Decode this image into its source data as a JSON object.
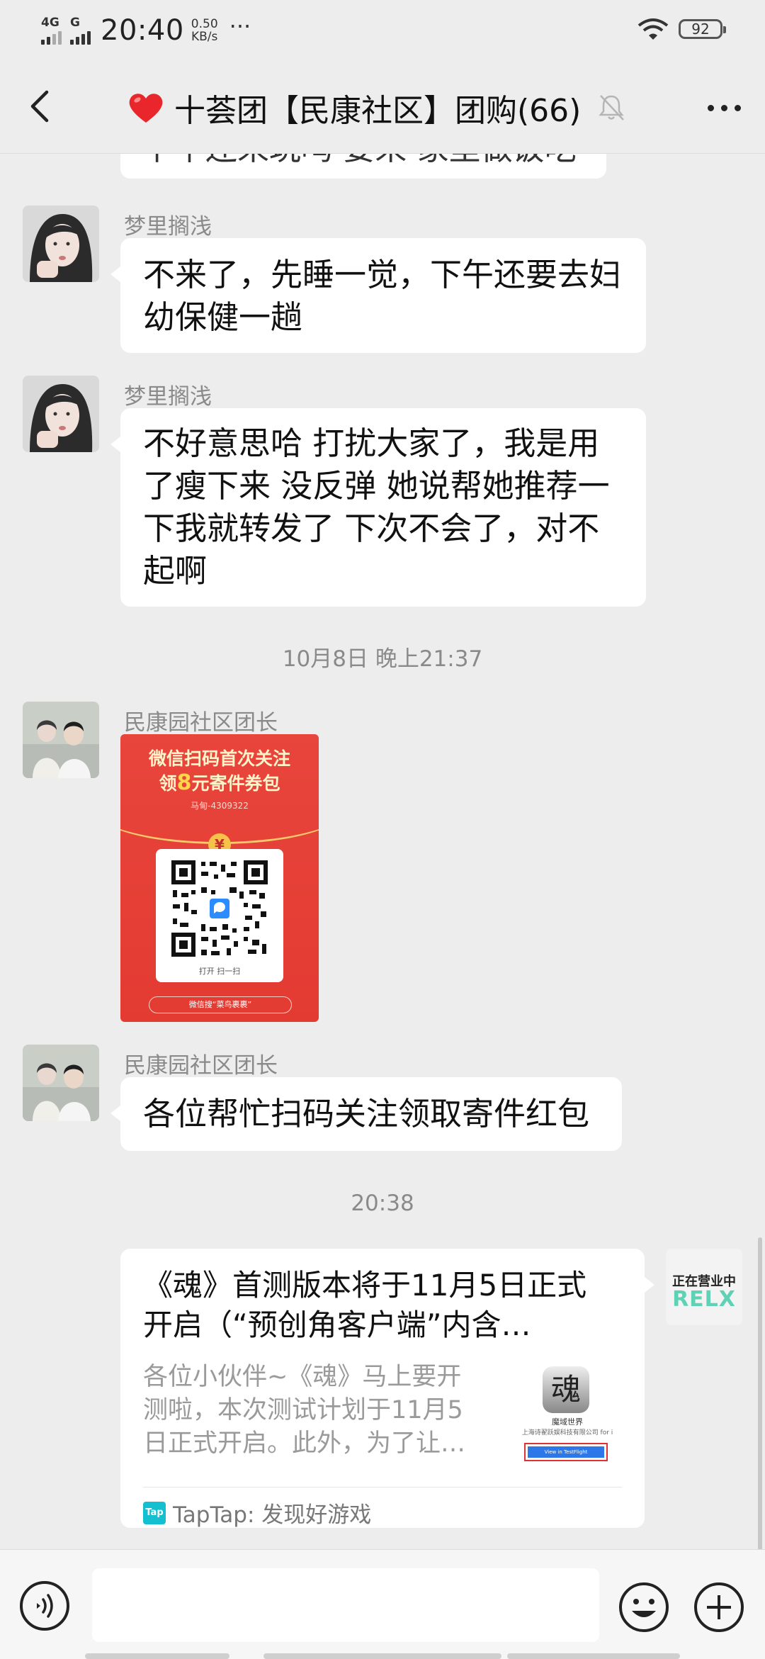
{
  "status_bar": {
    "network_1": "4G",
    "network_2": "G",
    "time": "20:40",
    "speed_value": "0.50",
    "speed_unit": "KB/s",
    "more": "···",
    "battery": "92"
  },
  "header": {
    "title": "十荟团【民康社区】团购(66)",
    "icons": [
      "back-icon",
      "heart-emoji",
      "mute-icon",
      "more-icon"
    ]
  },
  "messages": [
    {
      "type": "partial",
      "text": "下午还来玩吗 要来 家里做饭吃"
    },
    {
      "sender": "梦里搁浅",
      "text_lines": [
        "不来了，先睡一觉，下午还要去妇",
        "幼保健一趟"
      ]
    },
    {
      "sender": "梦里搁浅",
      "text_lines": [
        "不好意思哈 打扰大家了，我是用",
        "了瘦下来 没反弹 她说帮她推荐一",
        "下我就转发了 下次不会了，对不",
        "起啊"
      ]
    },
    {
      "type": "timestamp",
      "text": "10月8日 晚上21:37"
    },
    {
      "sender": "民康园社区团长",
      "type": "image",
      "image": {
        "title_line1": "微信扫码首次关注",
        "title_line2_pre": "领",
        "title_amount": "8",
        "title_line2_post": "元寄件券包",
        "sub": "马甸-4309322",
        "qr_caption": "打开 扫一扫",
        "brand": "微信搜“菜鸟裹裹”"
      }
    },
    {
      "sender": "民康园社区团长",
      "text_lines": [
        "各位帮忙扫码关注领取寄件红包"
      ]
    },
    {
      "type": "timestamp",
      "text": "20:38"
    },
    {
      "type": "link_card",
      "title_lines": [
        "《魂》首测版本将于11月5日正式",
        "开启（“预创角客户端”内含…"
      ],
      "desc_lines": [
        "各位小伙伴~《魂》马上要开",
        "测啦，本次测试计划于11月5",
        "日正式开启。此外，为了让…"
      ],
      "thumb": {
        "caption": "魔域世界",
        "company": "上海诗翟跃娱科技有限公司 for i",
        "button": "View in TestFlight",
        "glyph": "魂"
      },
      "source": "TapTap: 发现好游戏",
      "source_icon": "Tap",
      "self_avatar": {
        "line1": "正在营业中",
        "line2": "RELX"
      }
    }
  ],
  "input_bar": {
    "placeholder": "",
    "icons": [
      "voice-icon",
      "emoji-icon",
      "plus-icon"
    ]
  },
  "colors": {
    "background": "#ededed",
    "bubble": "#ffffff",
    "red_packet": "#e33b32",
    "timestamp": "#8a8a8a",
    "teal_brand": "#14bfd0"
  }
}
